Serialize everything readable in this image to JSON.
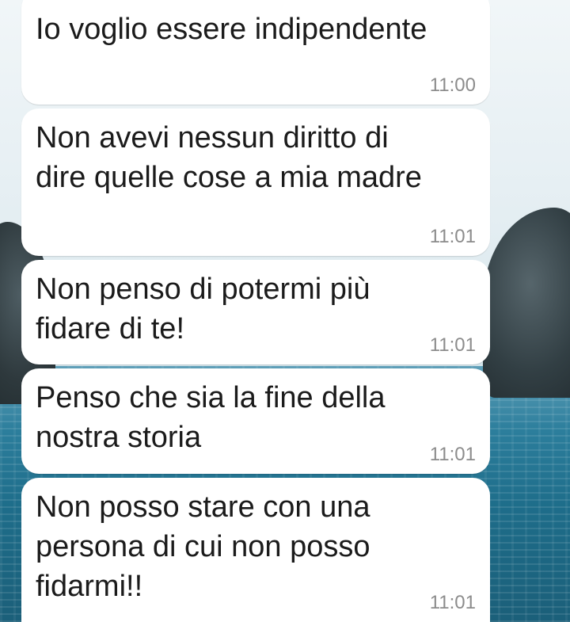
{
  "messages": [
    {
      "text": "Io voglio essere indipendente",
      "time": "11:00"
    },
    {
      "text": "Non avevi nessun diritto di\ndire quelle cose a mia madre",
      "time": "11:01"
    },
    {
      "text": "Non penso di potermi più\nfidare di te!",
      "time": "11:01"
    },
    {
      "text": "Penso che sia la fine della\nnostra storia",
      "time": "11:01"
    },
    {
      "text": "Non posso stare con una\npersona di cui non posso\nfidarmi!!",
      "time": "11:01"
    }
  ],
  "colors": {
    "bubble": "#ffffff",
    "text": "#1b1b1b",
    "timestamp": "#8c8c8c",
    "sea": "#1e6d8a",
    "sky": "#e6eff3"
  }
}
